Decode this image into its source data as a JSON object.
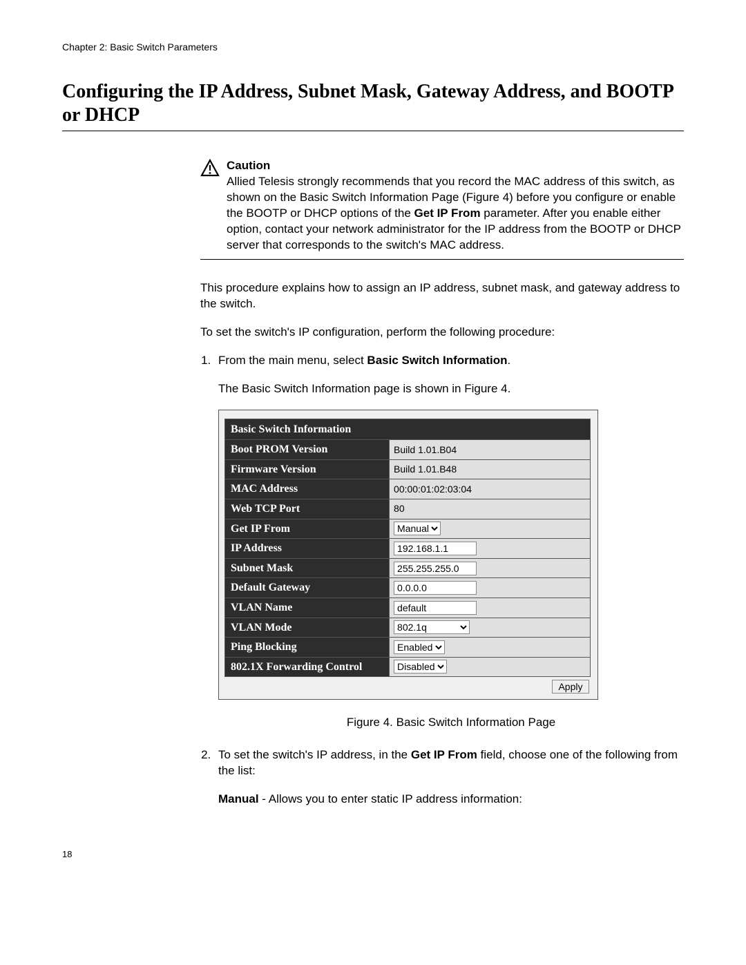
{
  "header": {
    "chapter": "Chapter 2: Basic Switch Parameters"
  },
  "title": "Configuring the IP Address, Subnet Mask, Gateway Address, and BOOTP or DHCP",
  "caution": {
    "title": "Caution",
    "text_pre": "Allied Telesis strongly recommends that you record the MAC address of this switch, as shown on the Basic Switch Information Page (Figure 4) before you configure or enable the BOOTP or DHCP options of the ",
    "bold1": "Get IP From",
    "text_post": " parameter. After you enable either option, contact your network administrator for the IP address from the BOOTP or DHCP server that corresponds to the switch's MAC address."
  },
  "para1": "This procedure explains how to assign an IP address, subnet mask, and gateway address to the switch.",
  "para2": "To set the switch's IP configuration, perform the following procedure:",
  "step1": {
    "pre": "From the main menu, select ",
    "bold": "Basic Switch Information",
    "post": ".",
    "sub": "The Basic Switch Information page is shown in Figure 4."
  },
  "figure": {
    "title": "Basic Switch Information",
    "caption": "Figure 4. Basic Switch Information Page",
    "apply": "Apply",
    "rows": {
      "boot_prom_label": "Boot PROM Version",
      "boot_prom_value": "Build 1.01.B04",
      "firmware_label": "Firmware Version",
      "firmware_value": "Build 1.01.B48",
      "mac_label": "MAC Address",
      "mac_value": "00:00:01:02:03:04",
      "web_tcp_label": "Web TCP Port",
      "web_tcp_value": "80",
      "get_ip_label": "Get IP From",
      "get_ip_value": "Manual",
      "ip_label": "IP Address",
      "ip_value": "192.168.1.1",
      "subnet_label": "Subnet Mask",
      "subnet_value": "255.255.255.0",
      "gateway_label": "Default Gateway",
      "gateway_value": "0.0.0.0",
      "vlan_name_label": "VLAN Name",
      "vlan_name_value": "default",
      "vlan_mode_label": "VLAN Mode",
      "vlan_mode_value": "802.1q",
      "ping_label": "Ping Blocking",
      "ping_value": "Enabled",
      "dot1x_label": "802.1X Forwarding Control",
      "dot1x_value": "Disabled"
    }
  },
  "step2": {
    "pre": "To set the switch's IP address, in the ",
    "bold": "Get IP From",
    "post": " field, choose one of the following from the list:"
  },
  "manual": {
    "bold": "Manual",
    "post": " - Allows you to enter static IP address information:"
  },
  "page_number": "18"
}
